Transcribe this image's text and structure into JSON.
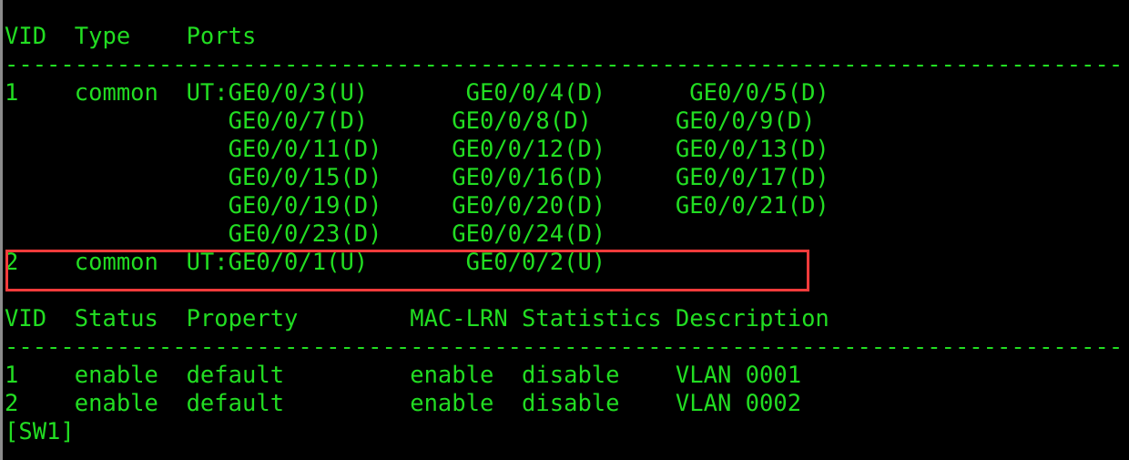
{
  "terminal": {
    "foreground_color": "#22dd22",
    "background_color": "#000000",
    "highlight_color": "#f43b3b",
    "prompt": "[SW1]"
  },
  "vlan_ports_table": {
    "headers": "VID  Type    Ports",
    "separator": "--------------------------------------------------------------------------------",
    "rows": [
      "1    common  UT:GE0/0/3(U)       GE0/0/4(D)      GE0/0/5(D)",
      "                GE0/0/7(D)      GE0/0/8(D)      GE0/0/9(D)",
      "                GE0/0/11(D)     GE0/0/12(D)     GE0/0/13(D)",
      "                GE0/0/15(D)     GE0/0/16(D)     GE0/0/17(D)",
      "                GE0/0/19(D)     GE0/0/20(D)     GE0/0/21(D)",
      "                GE0/0/23(D)     GE0/0/24(D)",
      "2    common  UT:GE0/0/1(U)       GE0/0/2(U)"
    ],
    "highlighted_row_index": 6,
    "column_labels": [
      "VID",
      "Type",
      "Ports"
    ],
    "vlans": [
      {
        "vid": "1",
        "type": "common",
        "tag_mode": "UT",
        "ports": [
          "GE0/0/3(U)",
          "GE0/0/4(D)",
          "GE0/0/5(D)",
          "GE0/0/7(D)",
          "GE0/0/8(D)",
          "GE0/0/9(D)",
          "GE0/0/11(D)",
          "GE0/0/12(D)",
          "GE0/0/13(D)",
          "GE0/0/15(D)",
          "GE0/0/16(D)",
          "GE0/0/17(D)",
          "GE0/0/19(D)",
          "GE0/0/20(D)",
          "GE0/0/21(D)",
          "GE0/0/23(D)",
          "GE0/0/24(D)"
        ]
      },
      {
        "vid": "2",
        "type": "common",
        "tag_mode": "UT",
        "ports": [
          "GE0/0/1(U)",
          "GE0/0/2(U)"
        ]
      }
    ]
  },
  "vlan_properties_table": {
    "headers": "VID  Status  Property        MAC-LRN Statistics Description",
    "separator": "--------------------------------------------------------------------------------",
    "rows": [
      "1    enable  default         enable  disable    VLAN 0001",
      "2    enable  default         enable  disable    VLAN 0002"
    ],
    "column_labels": [
      "VID",
      "Status",
      "Property",
      "MAC-LRN",
      "Statistics",
      "Description"
    ],
    "vlans": [
      {
        "vid": "1",
        "status": "enable",
        "property": "default",
        "mac_lrn": "enable",
        "statistics": "disable",
        "description": "VLAN 0001"
      },
      {
        "vid": "2",
        "status": "enable",
        "property": "default",
        "mac_lrn": "enable",
        "statistics": "disable",
        "description": "VLAN 0002"
      }
    ]
  }
}
